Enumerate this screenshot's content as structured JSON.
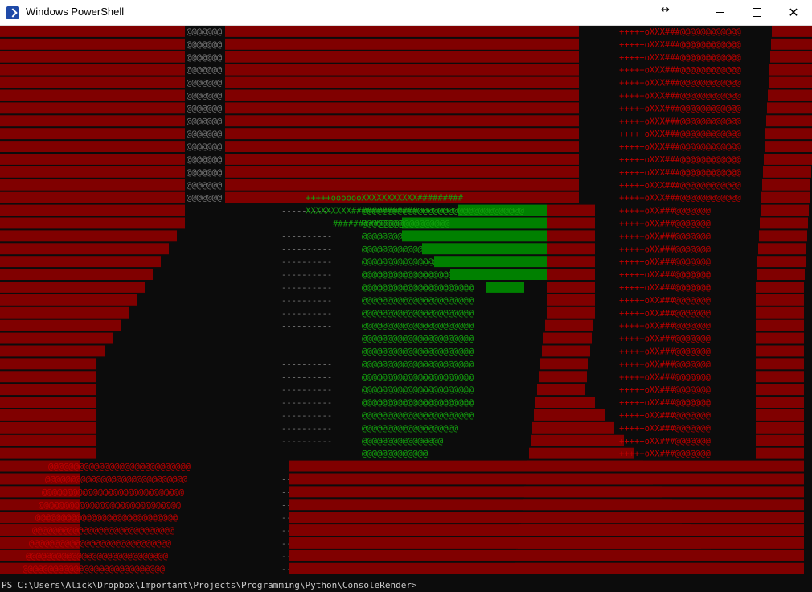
{
  "window": {
    "title": "Windows PowerShell",
    "resize_glyph": "↔",
    "minimize_glyph": "",
    "close_glyph": "✕"
  },
  "console": {
    "prompt": "PS C:\\Users\\Alick\\Dropbox\\Important\\Projects\\Programming\\Python\\ConsoleRender>",
    "colors": {
      "background": "#0c0c0c",
      "red": "#800000",
      "red_text": "#c00000",
      "green": "#008000",
      "green_text": "#13a10e",
      "gray_text": "#767676"
    }
  },
  "ascii_art": {
    "characters": [
      "@",
      "#",
      "X",
      "o",
      "+",
      "-"
    ],
    "sample_runs": [
      "@@@@@@@",
      "+++++oXXX###@@@@@@@@@@@@",
      "+++++ooooooXXXXXXXXXXX#########",
      "XXXXXXXXX#############@@@@@@@@@@@@@@@@@@@@@",
      "#########@@@@@@@@@@@@@@"
    ]
  }
}
